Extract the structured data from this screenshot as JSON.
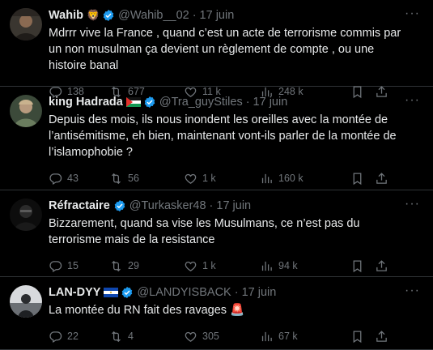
{
  "tweets": [
    {
      "name": "Wahib",
      "flag_emoji": "🦁",
      "handle": "@Wahib__02",
      "separator": "·",
      "time": "17 juin",
      "text": "Mdrrr vive la France , quand c’est un acte de terrorisme commis par un non musulman ça devient un règlement de compte , ou une histoire banal",
      "replies": "138",
      "retweets": "677",
      "likes": "11 k",
      "views": "248 k"
    },
    {
      "name": "king Hadrada",
      "flag_emoji": "🇵🇸",
      "handle": "@Tra_guyStiles",
      "separator": "·",
      "time": "17 juin",
      "text": "Depuis des mois, ils nous inondent les oreilles avec la montée de l’antisémitisme, eh bien, maintenant vont-ils parler de la montée de l’islamophobie ?",
      "replies": "43",
      "retweets": "56",
      "likes": "1 k",
      "views": "160 k"
    },
    {
      "name": "Réfractaire",
      "flag_emoji": "",
      "handle": "@Turkasker48",
      "separator": "·",
      "time": "17 juin",
      "text": "Bizzarement, quand sa vise les Musulmans, ce n’est pas du terrorisme mais de la resistance",
      "replies": "15",
      "retweets": "29",
      "likes": "1 k",
      "views": "94 k"
    },
    {
      "name": "LAN-DYY",
      "flag_emoji": "🇸🇻",
      "handle": "@LANDYISBACK",
      "separator": "·",
      "time": "17 juin",
      "text": "La montée du RN fait des ravages 🚨",
      "replies": "22",
      "retweets": "4",
      "likes": "305",
      "views": "67 k"
    }
  ],
  "colors": {
    "background": "#000000",
    "text": "#e7e9ea",
    "muted": "#71767b",
    "divider": "#2f3336",
    "verified": "#1d9bf0"
  },
  "icons": [
    "reply-icon",
    "retweet-icon",
    "like-icon",
    "views-icon",
    "bookmark-icon",
    "share-icon",
    "more-icon",
    "verified-badge-icon"
  ]
}
